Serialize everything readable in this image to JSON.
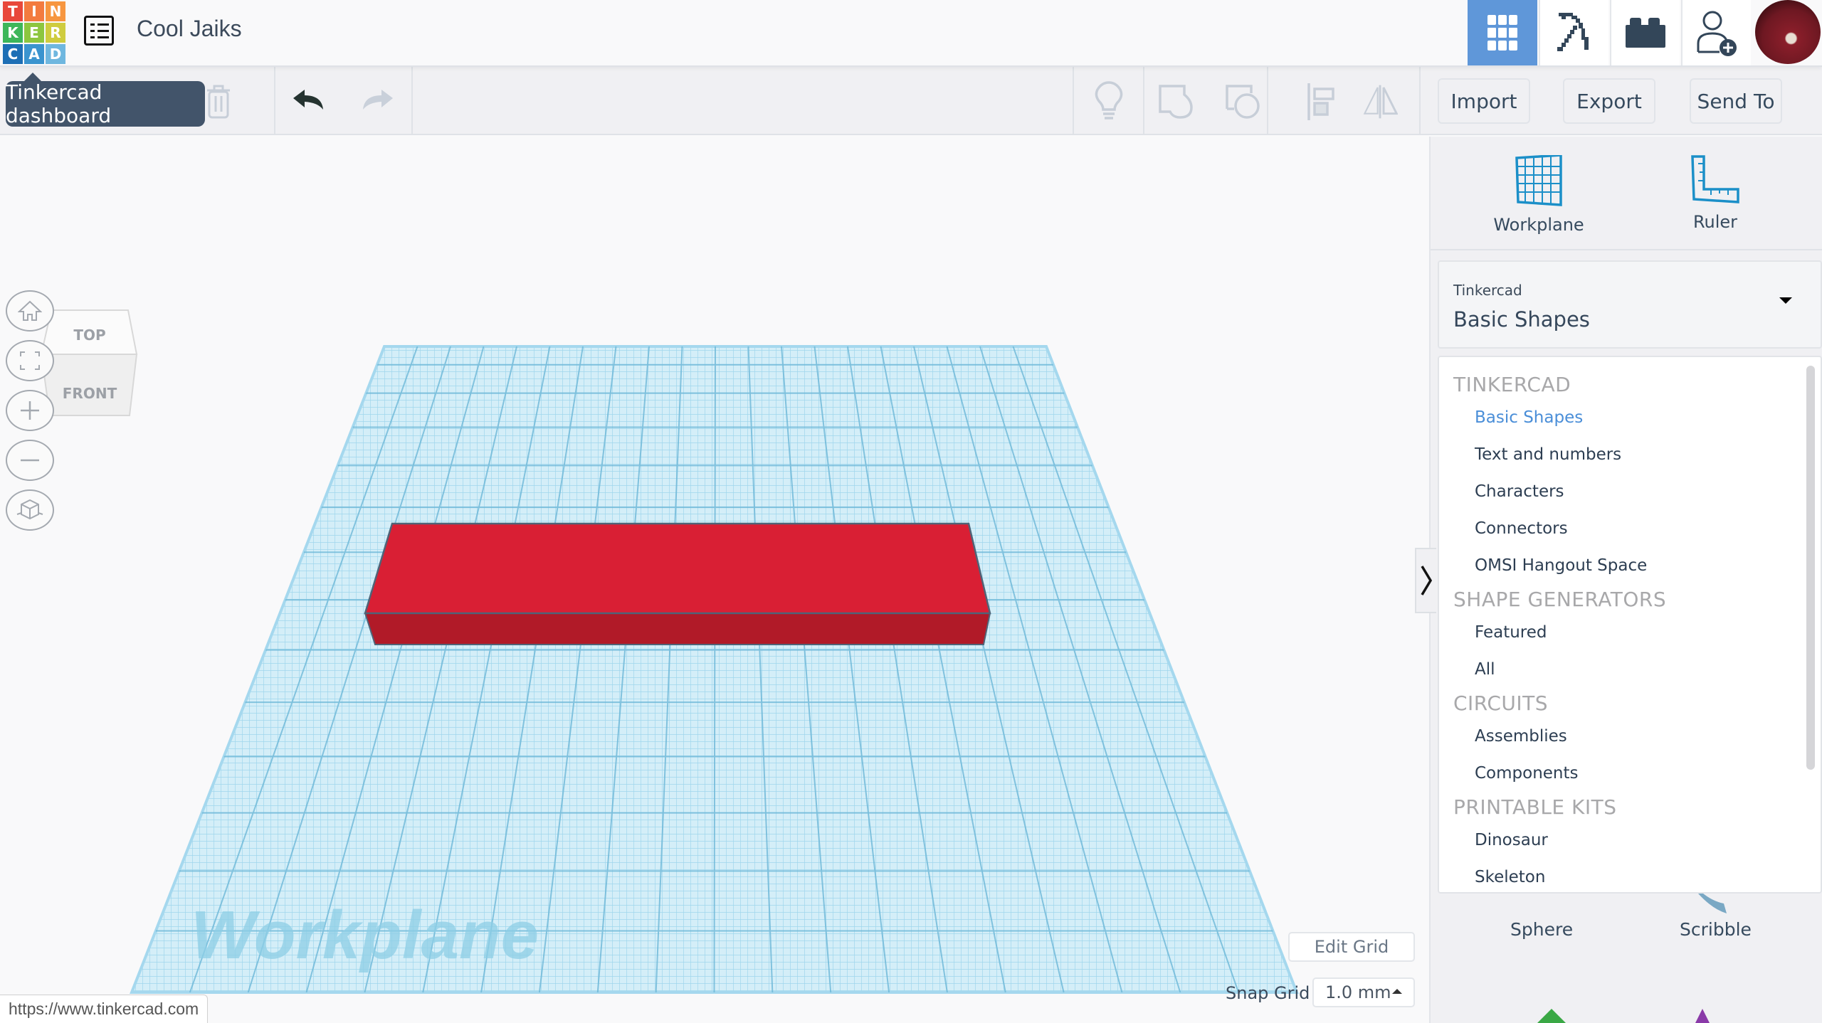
{
  "header": {
    "logo_letters": [
      "T",
      "I",
      "N",
      "K",
      "E",
      "R",
      "C",
      "A",
      "D"
    ],
    "logo_colors": [
      "#e8483b",
      "#f37b3f",
      "#f7963f",
      "#3db65a",
      "#8dc63f",
      "#cfcc3f",
      "#1d6fb5",
      "#3a94cf",
      "#6fb7df"
    ],
    "project_title": "Cool Jaiks",
    "buttons": [
      {
        "name": "3d-design-view",
        "icon": "grid-icon",
        "active": true
      },
      {
        "name": "minecraft-view",
        "icon": "pickaxe-icon",
        "active": false
      },
      {
        "name": "lego-bricks-view",
        "icon": "brick-icon",
        "active": false
      },
      {
        "name": "invite-people",
        "icon": "user-add-icon",
        "active": false
      }
    ],
    "accent_color": "#5f97d9"
  },
  "tooltip": {
    "text": "Tinkercad dashboard"
  },
  "toolbar": {
    "edit_icons": [
      "copy-icon",
      "paste-icon",
      "duplicate-icon",
      "delete-icon"
    ],
    "undo_icon": "undo-icon",
    "redo_icon": "redo-icon",
    "shape_tools": [
      "lightbulb-icon",
      "group-icon",
      "ungroup-icon",
      "align-icon",
      "mirror-icon"
    ],
    "import_label": "Import",
    "export_label": "Export",
    "send_to_label": "Send To"
  },
  "viewcube": {
    "top_label": "TOP",
    "front_label": "FRONT"
  },
  "nav_controls": [
    "home-icon",
    "fit-view-icon",
    "zoom-in-icon",
    "zoom-out-icon",
    "perspective-icon"
  ],
  "canvas": {
    "workplane_label": "Workplane",
    "object_color_top": "#d91f34",
    "object_color_front": "#b11a28",
    "edit_grid_label": "Edit Grid",
    "snap_grid_label": "Snap Grid",
    "snap_grid_value": "1.0 mm"
  },
  "status_url": "https://www.tinkercad.com",
  "side_panel": {
    "tools": [
      {
        "label": "Workplane",
        "icon": "workplane-icon"
      },
      {
        "label": "Ruler",
        "icon": "ruler-icon"
      }
    ],
    "library": {
      "provider": "Tinkercad",
      "selected": "Basic Shapes"
    },
    "dropdown_groups": [
      {
        "title": "TINKERCAD",
        "items": [
          "Basic Shapes",
          "Text and numbers",
          "Characters",
          "Connectors",
          "OMSI Hangout Space"
        ]
      },
      {
        "title": "SHAPE GENERATORS",
        "items": [
          "Featured",
          "All"
        ]
      },
      {
        "title": "CIRCUITS",
        "items": [
          "Assemblies",
          "Components"
        ]
      },
      {
        "title": "PRINTABLE KITS",
        "items": [
          "Dinosaur",
          "Skeleton"
        ]
      }
    ],
    "shapes": [
      "Sphere",
      "Scribble"
    ]
  }
}
